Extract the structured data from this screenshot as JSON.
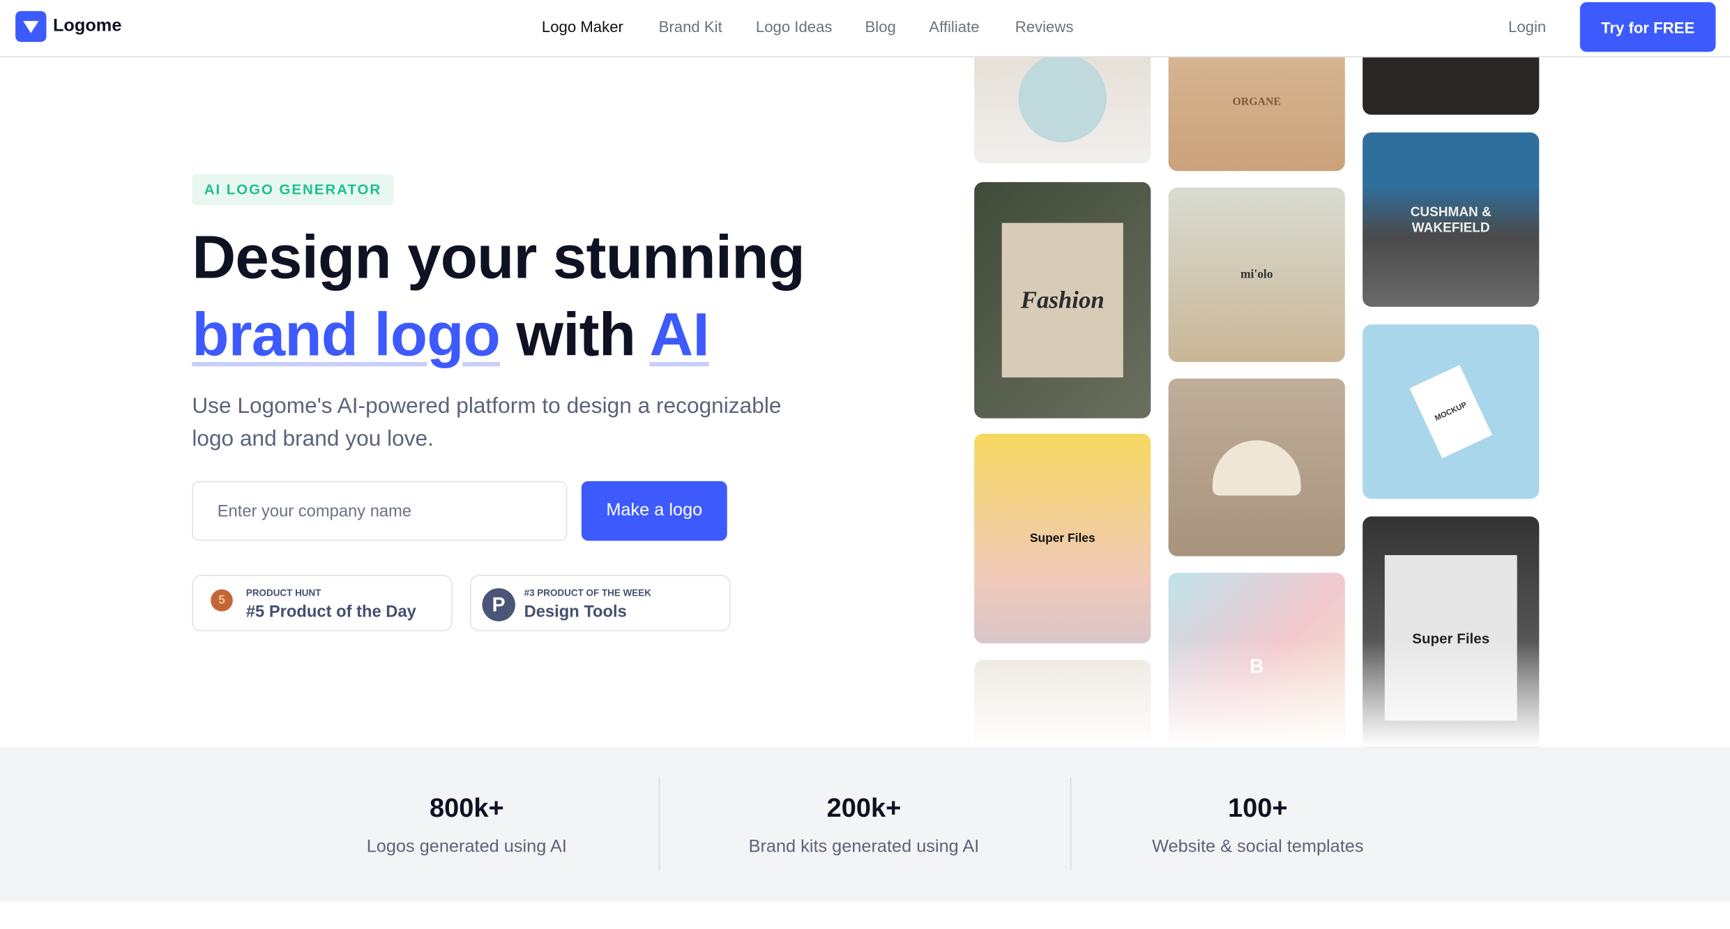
{
  "nav": {
    "brand": "Logome",
    "links": [
      "Logo Maker",
      "Brand Kit",
      "Logo Ideas",
      "Blog",
      "Affiliate",
      "Reviews"
    ],
    "login": "Login",
    "cta": "Try for FREE"
  },
  "hero": {
    "tag": "AI LOGO GENERATOR",
    "title_line1": "Design your stunning",
    "title_blue1": "brand logo",
    "title_mid": " with ",
    "title_blue2": "AI",
    "subtitle": "Use Logome's AI-powered platform to design a recognizable logo and brand you love.",
    "input_placeholder": "Enter your company name",
    "button": "Make a logo"
  },
  "badges": [
    {
      "icon": "medal-icon",
      "number": "5",
      "small": "PRODUCT HUNT",
      "big": "#5 Product of the Day"
    },
    {
      "icon": "producthunt-icon",
      "letter": "P",
      "small": "#3 PRODUCT OF THE WEEK",
      "big": "Design Tools"
    }
  ],
  "gallery": [
    "ORGANE",
    "Fashion",
    "mi'olo",
    "CUSHMAN & WAKEFIELD",
    "Super Files",
    "MOCKUP",
    "B",
    "Super Files"
  ],
  "stats": [
    {
      "value": "800k+",
      "label": "Logos generated using AI"
    },
    {
      "value": "200k+",
      "label": "Brand kits generated using AI"
    },
    {
      "value": "100+",
      "label": "Website & social templates"
    }
  ],
  "colors": {
    "accent": "#3d5afe",
    "tag_green": "#1fbf8f"
  }
}
